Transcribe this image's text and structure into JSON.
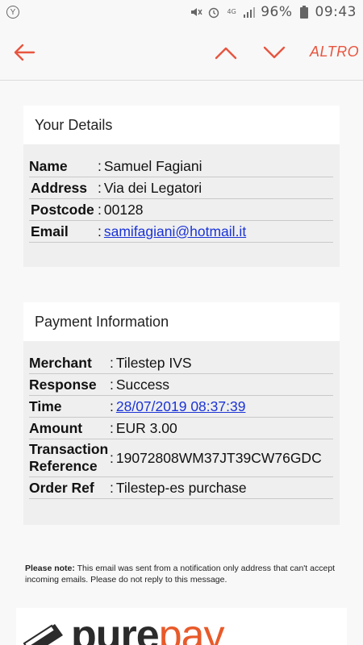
{
  "status_bar": {
    "battery": "96%",
    "time": "09:43",
    "network": "4G"
  },
  "app_bar": {
    "more_label": "ALTRO"
  },
  "colors": {
    "accent": "#e8553f",
    "link": "#1a33d6"
  },
  "details": {
    "title": "Your Details",
    "rows": [
      {
        "label": "Name",
        "value": "Samuel Fagiani"
      },
      {
        "label": "Address",
        "value": "Via dei Legatori"
      },
      {
        "label": "Postcode",
        "value": "00128"
      },
      {
        "label": "Email",
        "value": "samifagiani@hotmail.it"
      }
    ]
  },
  "payment": {
    "title": "Payment Information",
    "rows": [
      {
        "label": "Merchant",
        "value": "Tilestep IVS"
      },
      {
        "label": "Response",
        "value": "Success"
      },
      {
        "label": "Time",
        "value": "28/07/2019 08:37:39"
      },
      {
        "label": "Amount",
        "value": "EUR 3.00"
      },
      {
        "label": "Transaction Reference",
        "value": "19072808WM37JT39CW76GDC"
      },
      {
        "label": "Order Ref",
        "value": "Tilestep-es purchase"
      }
    ]
  },
  "note": {
    "label": "Please note:",
    "text": " This email was sent from a notification only address that can't accept incoming emails. Please do not reply to this message."
  },
  "logo": {
    "part1": "pure",
    "part2": "pay"
  },
  "separator": ":"
}
